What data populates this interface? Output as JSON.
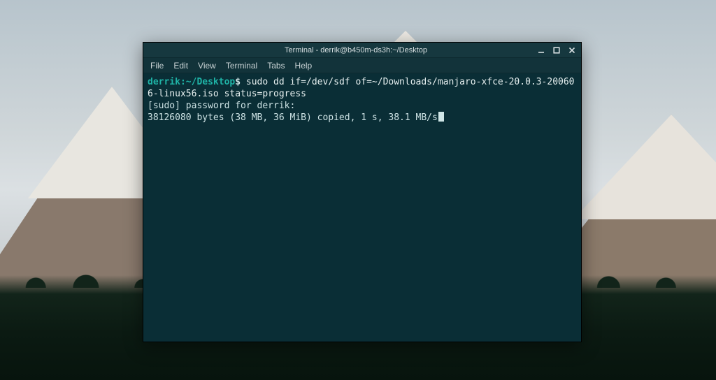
{
  "window": {
    "title": "Terminal - derrik@b450m-ds3h:~/Desktop"
  },
  "menubar": {
    "items": [
      "File",
      "Edit",
      "View",
      "Terminal",
      "Tabs",
      "Help"
    ]
  },
  "prompt": {
    "user_host": "derrik:",
    "path": "~/Desktop",
    "separator": "$"
  },
  "terminal": {
    "command": "sudo dd if=/dev/sdf of=~/Downloads/manjaro-xfce-20.0.3-200606-linux56.iso status=progress",
    "lines": [
      "[sudo] password for derrik:",
      "38126080 bytes (38 MB, 36 MiB) copied, 1 s, 38.1 MB/s"
    ]
  }
}
